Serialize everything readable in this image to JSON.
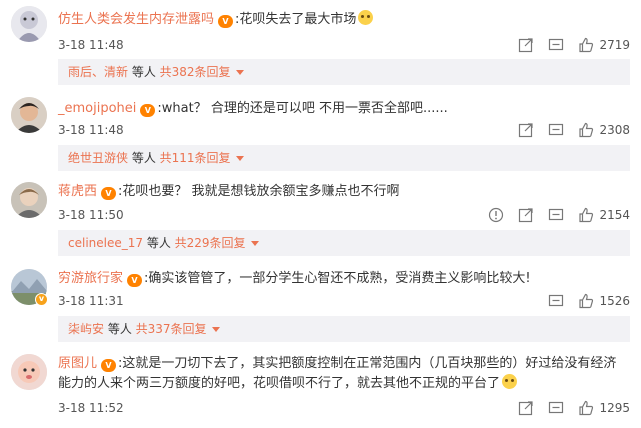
{
  "comments": [
    {
      "user": "仿生人类会发生内存泄露吗",
      "text": ":花呗失去了最大市场",
      "time": "3-18 11:48",
      "likes": "2719",
      "replies": {
        "names": "雨后、清新",
        "mid": " 等人 ",
        "count": "共382条回复"
      }
    },
    {
      "user": "_emojipohei",
      "text": ":what？ 合理的还是可以吧 不用一票否全部吧......",
      "time": "3-18 11:48",
      "likes": "2308",
      "replies": {
        "names": "绝世丑游侠",
        "mid": " 等人 ",
        "count": "共111条回复"
      }
    },
    {
      "user": "蒋虎西",
      "text": ":花呗也要？ 我就是想钱放余额宝多赚点也不行啊",
      "time": "3-18 11:50",
      "likes": "2154",
      "replies": {
        "names": "celinelee_17",
        "mid": " 等人 ",
        "count": "共229条回复"
      }
    },
    {
      "user": "穷游旅行家",
      "text": ":确实该管管了，一部分学生心智还不成熟，受消费主义影响比较大!",
      "time": "3-18 11:31",
      "likes": "1526",
      "replies": {
        "names": "柒屿安",
        "mid": " 等人 ",
        "count": "共337条回复"
      }
    },
    {
      "user": "原图儿",
      "text": ":这就是一刀切下去了，其实把额度控制在正常范围内（几百块那些的）好过给没有经济能力的人来个两三万额度的好吧，花呗借呗不行了，就去其他不正规的平台了",
      "time": "3-18 11:52",
      "likes": "1295"
    }
  ],
  "colors": {
    "username": "#eb7350",
    "reply_bg": "#f2f2f5",
    "text": "#333333",
    "meta": "#555555"
  },
  "icons": [
    "share-icon",
    "comment-icon",
    "like-icon",
    "report-icon",
    "vip-badge-icon",
    "emoji-icon"
  ]
}
